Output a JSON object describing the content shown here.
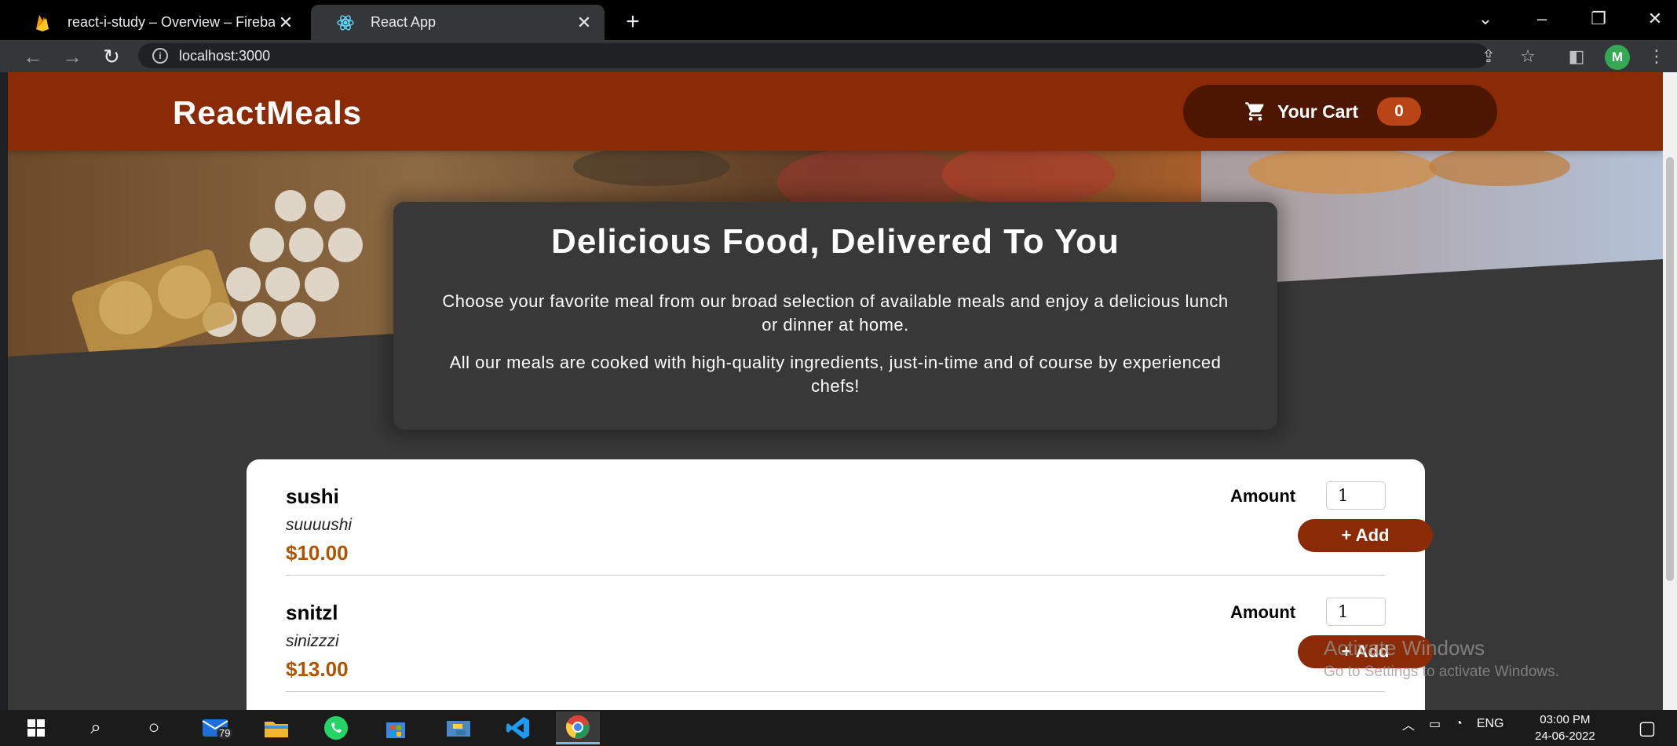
{
  "browser": {
    "tabs": [
      {
        "title": "react-i-study – Overview – Fireba",
        "favicon": "firebase-icon",
        "active": false
      },
      {
        "title": "React App",
        "favicon": "react-icon",
        "active": true
      }
    ],
    "url": "localhost:3000",
    "profile_initial": "M"
  },
  "app": {
    "brand": "ReactMeals",
    "cart": {
      "label": "Your Cart",
      "count": "0",
      "icon": "cart-icon"
    }
  },
  "summary": {
    "title": "Delicious Food, Delivered To You",
    "paragraph1": "Choose your favorite meal from our broad selection of available meals and enjoy a delicious lunch or dinner at home.",
    "paragraph2": "All our meals are cooked with high-quality ingredients, just-in-time and of course by experienced chefs!"
  },
  "meals": [
    {
      "name": "sushi",
      "description": "suuuushi",
      "price": "$10.00",
      "amount_label": "Amount",
      "amount": "1",
      "add_label": "+ Add"
    },
    {
      "name": "snitzl",
      "description": "sinizzzi",
      "price": "$13.00",
      "amount_label": "Amount",
      "amount": "1",
      "add_label": "+ Add"
    }
  ],
  "watermark": {
    "title": "Activate Windows",
    "subtitle": "Go to Settings to activate Windows."
  },
  "taskbar": {
    "mail_badge": "79",
    "language": "ENG",
    "time": "03:00 PM",
    "date": "24-06-2022"
  },
  "colors": {
    "header": "#8a2b06",
    "cart_bg": "#4d1601",
    "badge": "#b94517",
    "price": "#ad5502",
    "page_bg": "#383838"
  }
}
